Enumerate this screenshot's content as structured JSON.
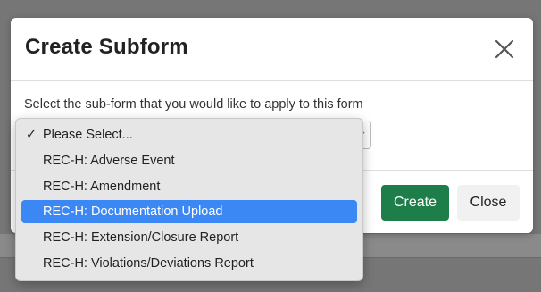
{
  "modal": {
    "title": "Create Subform",
    "prompt": "Select the sub-form that you would like to apply to this form",
    "create_label": "Create",
    "close_label": "Close"
  },
  "select": {
    "options": [
      {
        "label": "Please Select...",
        "selected": true,
        "check": "✓"
      },
      {
        "label": "REC-H: Adverse Event",
        "selected": false,
        "check": ""
      },
      {
        "label": "REC-H: Amendment",
        "selected": false,
        "check": ""
      },
      {
        "label": "REC-H: Documentation Upload",
        "selected": false,
        "check": ""
      },
      {
        "label": "REC-H: Extension/Closure Report",
        "selected": false,
        "check": ""
      },
      {
        "label": "REC-H: Violations/Deviations Report",
        "selected": false,
        "check": ""
      }
    ],
    "highlighted_index": 3
  },
  "colors": {
    "primary_button": "#1e7e4a",
    "highlight": "#3b88f4",
    "backdrop": "#767676"
  },
  "icons": {
    "close": "close-icon",
    "check": "checkmark-icon",
    "chevron": "chevron-down-icon"
  }
}
